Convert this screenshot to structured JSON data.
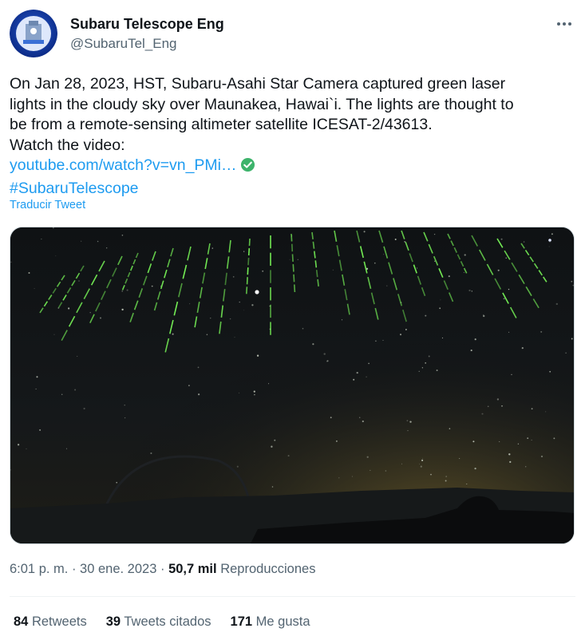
{
  "author": {
    "display_name": "Subaru Telescope Eng",
    "handle": "@SubaruTel_Eng",
    "avatar_text": "SUBARU TELESCOPE"
  },
  "tweet": {
    "line1": "On Jan 28, 2023, HST, Subaru-Asahi Star Camera captured green laser",
    "line2": "lights in the cloudy sky over Maunakea, Hawai`i. The lights are thought to",
    "line3": "be from a remote-sensing altimeter satellite ICESAT-2/43613.",
    "line4": "Watch the video:",
    "link": "youtube.com/watch?v=vn_PMi…",
    "hashtag": "#SubaruTelescope"
  },
  "translate_label": "Traducir Tweet",
  "meta": {
    "time": "6:01 p. m.",
    "sep1": " · ",
    "date": "30 ene. 2023",
    "sep2": " · ",
    "views_count": "50,7 mil",
    "views_label": "Reproducciones"
  },
  "stats": {
    "retweets_count": "84",
    "retweets_label": "Retweets",
    "quotes_count": "39",
    "quotes_label": "Tweets citados",
    "likes_count": "171",
    "likes_label": "Me gusta"
  },
  "colors": {
    "link": "#1d9bf0",
    "text": "#0f1419",
    "secondary": "#536471",
    "laser": "#7CFF5A"
  },
  "icons": {
    "verified": "check-circle-icon",
    "more": "more-dots-icon"
  }
}
